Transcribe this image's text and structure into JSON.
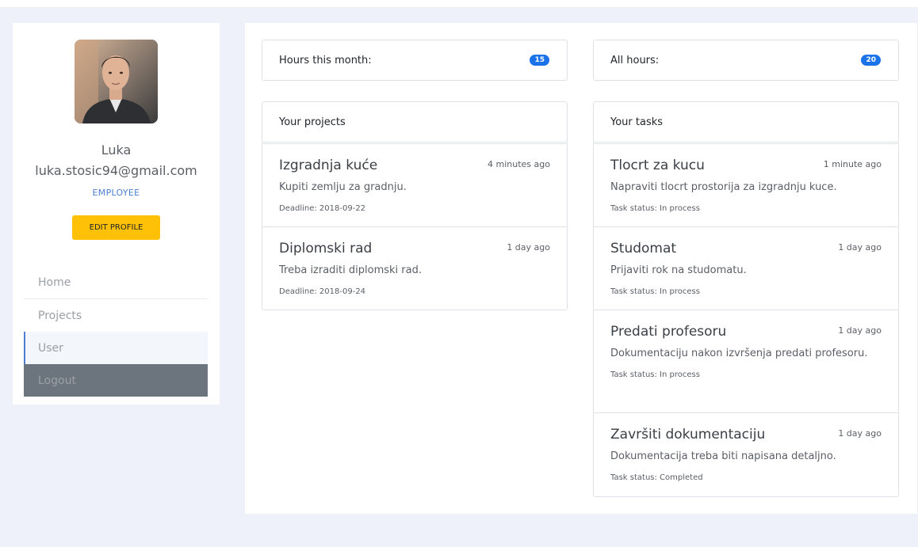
{
  "profile": {
    "name": "Luka",
    "email": "luka.stosic94@gmail.com",
    "role": "EMPLOYEE",
    "edit_label": "EDIT PROFILE"
  },
  "nav": {
    "home": "Home",
    "projects": "Projects",
    "user": "User",
    "logout": "Logout"
  },
  "stats": {
    "month_label": "Hours this month:",
    "month_value": "15",
    "all_label": "All hours:",
    "all_value": "20"
  },
  "projects": {
    "header": "Your projects",
    "items": [
      {
        "title": "Izgradnja kuće",
        "time": "4 minutes ago",
        "desc": "Kupiti zemlju za gradnju.",
        "meta": "Deadline: 2018-09-22"
      },
      {
        "title": "Diplomski rad",
        "time": "1 day ago",
        "desc": "Treba izraditi diplomski rad.",
        "meta": "Deadline: 2018-09-24"
      }
    ]
  },
  "tasks": {
    "header": "Your tasks",
    "items": [
      {
        "title": "Tlocrt za kucu",
        "time": "1 minute ago",
        "desc": "Napraviti tlocrt prostorija za izgradnju kuce.",
        "meta": "Task status: In process"
      },
      {
        "title": "Studomat",
        "time": "1 day ago",
        "desc": "Prijaviti rok na studomatu.",
        "meta": "Task status: In process"
      },
      {
        "title": "Predati profesoru",
        "time": "1 day ago",
        "desc": "Dokumentaciju nakon izvršenja predati profesoru.",
        "meta": "Task status: In process"
      },
      {
        "title": "Završiti dokumentaciju",
        "time": "1 day ago",
        "desc": "Dokumentacija treba biti napisana detaljno.",
        "meta": "Task status: Completed"
      }
    ]
  },
  "colors": {
    "accent": "#1a73e8",
    "warning": "#ffc107",
    "role": "#4d7fcf",
    "logout_bg": "#6c757d"
  }
}
